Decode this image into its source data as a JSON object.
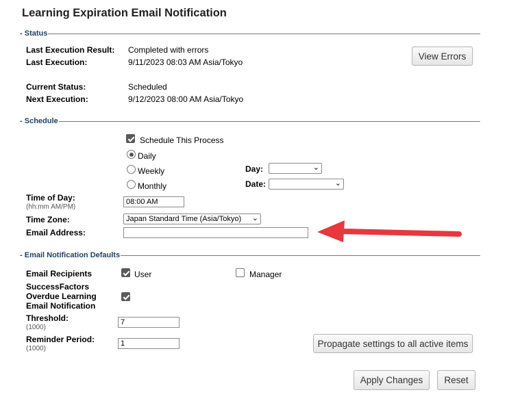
{
  "page": {
    "title": "Learning Expiration Email Notification"
  },
  "status": {
    "legend": "Status",
    "last_result_label": "Last Execution Result:",
    "last_result_value": "Completed with errors",
    "last_execution_label": "Last Execution:",
    "last_execution_value": "9/11/2023 08:03 AM Asia/Tokyo",
    "current_status_label": "Current Status:",
    "current_status_value": "Scheduled",
    "next_execution_label": "Next Execution:",
    "next_execution_value": "9/12/2023 08:00 AM Asia/Tokyo",
    "view_errors_label": "View Errors"
  },
  "schedule": {
    "legend": "Schedule",
    "schedule_process_label": "Schedule This Process",
    "schedule_process_checked": true,
    "frequency_options": [
      "Daily",
      "Weekly",
      "Monthly"
    ],
    "frequency_selected": "Daily",
    "day_label": "Day:",
    "day_value": "",
    "date_label": "Date:",
    "date_value": "",
    "time_label": "Time of Day:",
    "time_hint": "(hh:mm AM/PM)",
    "time_value": "08:00 AM",
    "timezone_label": "Time Zone:",
    "timezone_value": "Japan Standard Time (Asia/Tokyo)",
    "email_label": "Email Address:",
    "email_value": ""
  },
  "defaults": {
    "legend": "Email Notification Defaults",
    "recipients_label": "Email Recipients",
    "user_label": "User",
    "user_checked": true,
    "manager_label": "Manager",
    "manager_checked": false,
    "sf_line1": "SuccessFactors",
    "sf_line2": "Overdue Learning",
    "sf_line3": "Email Notification",
    "sf_checked": true,
    "threshold_label": "Threshold:",
    "threshold_hint": "(1000)",
    "threshold_value": "7",
    "reminder_label": "Reminder Period:",
    "reminder_hint": "(1000)",
    "reminder_value": "1",
    "propagate_label": "Propagate settings to all active items"
  },
  "footer": {
    "apply_label": "Apply Changes",
    "reset_label": "Reset"
  },
  "annotation": {
    "arrow_color": "#e8373d"
  }
}
